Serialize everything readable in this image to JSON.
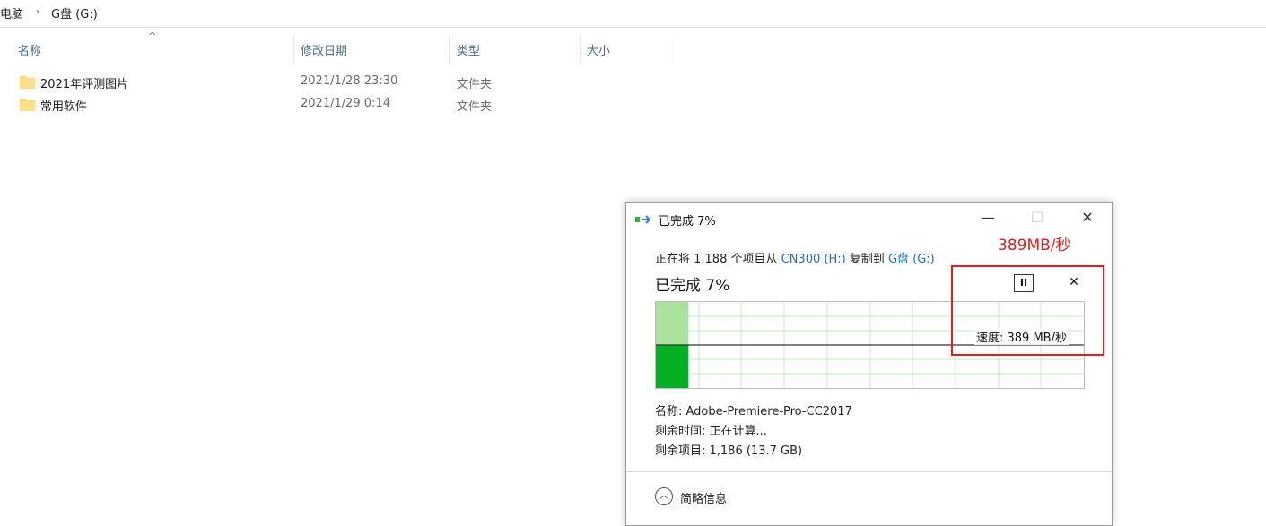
{
  "breadcrumb": {
    "items": [
      "电脑",
      "G盘 (G:)"
    ],
    "separator": "›"
  },
  "columns": {
    "name": "名称",
    "date_modified": "修改日期",
    "type": "类型",
    "size": "大小"
  },
  "files": [
    {
      "name": "2021年评测图片",
      "date": "2021/1/28 23:30",
      "type": "文件夹",
      "icon": "folder-icon"
    },
    {
      "name": "常用软件",
      "date": "2021/1/29 0:14",
      "type": "文件夹",
      "icon": "folder-icon"
    }
  ],
  "dialog": {
    "title": "已完成 7%",
    "window_buttons": {
      "minimize": "—",
      "maximize": "☐",
      "close": "✕"
    },
    "copy_line": {
      "prefix": "正在将 1,188 个项目从 ",
      "source": "CN300 (H:)",
      "middle": " 复制到 ",
      "destination": "G盘 (G:)"
    },
    "progress_title": "已完成 7%",
    "progress_percent": 7,
    "pause_label": "II",
    "cancel_label": "✕",
    "speed_annotation": "389MB/秒",
    "speed_label": "速度: 389 MB/秒",
    "name_line": "名称: Adobe-Premiere-Pro-CC2017",
    "time_left_line": "剩余时间: 正在计算...",
    "items_left_line": "剩余项目: 1,186 (13.7 GB)",
    "collapse_label": "简略信息",
    "colors": {
      "accent_green": "#06b025",
      "light_green": "#a8e29c",
      "grid": "#c9e8c4",
      "annotation_red": "#e02020",
      "link_blue": "#1f6fc4"
    }
  }
}
